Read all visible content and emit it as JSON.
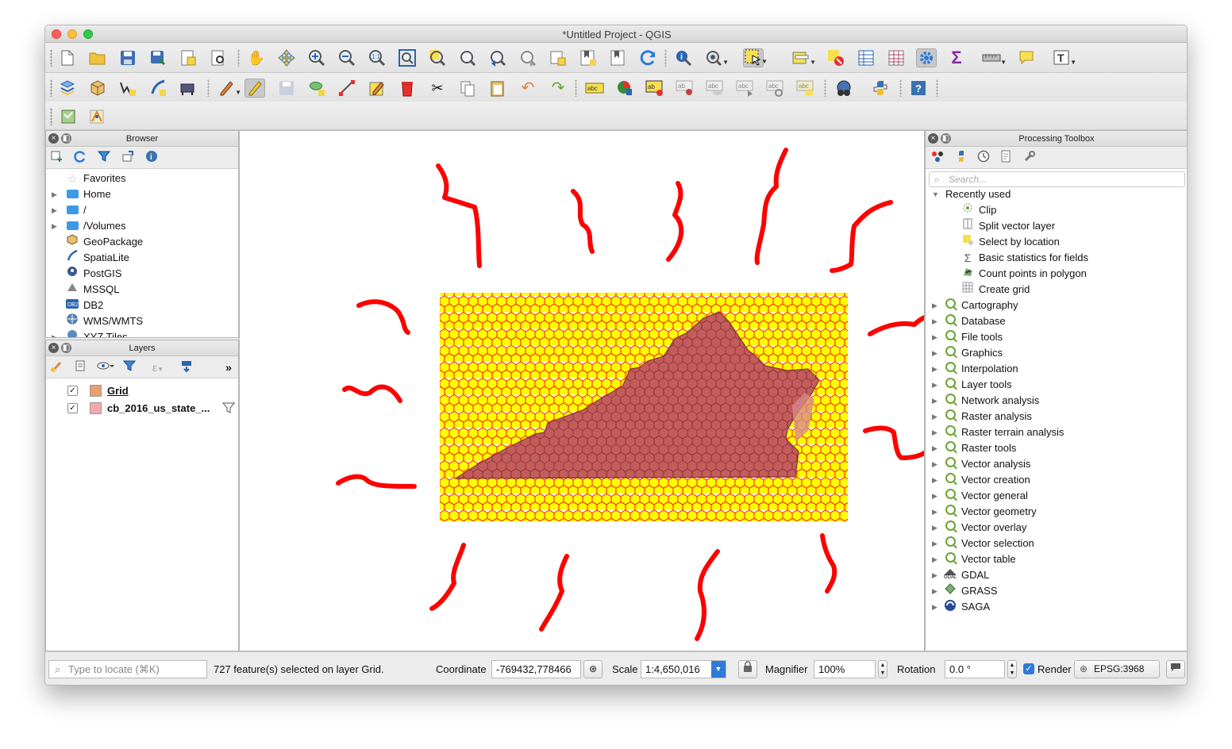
{
  "window": {
    "title": "*Untitled Project - QGIS"
  },
  "toolbar1": {
    "icons": [
      "new-project-icon",
      "open-project-icon",
      "save-project-icon",
      "save-as-icon",
      "new-print-layout-icon",
      "layout-manager-icon",
      "pan-icon",
      "pan-to-selection-icon",
      "zoom-in-icon",
      "zoom-out-icon",
      "zoom-native-icon",
      "zoom-full-icon",
      "zoom-to-selection-icon",
      "zoom-to-layer-icon",
      "zoom-last-icon",
      "zoom-next-icon",
      "new-map-view-icon",
      "new-bookmark-icon",
      "show-bookmarks-icon",
      "refresh-icon",
      "identify-icon",
      "run-action-icon",
      "select-features-icon",
      "select-by-value-icon",
      "deselect-icon",
      "attribute-table-icon",
      "field-calculator-icon",
      "processing-toolbox-icon",
      "statistics-icon",
      "measure-icon",
      "map-tips-icon",
      "text-annotation-icon"
    ]
  },
  "toolbar2": {
    "icons": [
      "data-source-manager-icon",
      "new-geopackage-layer-icon",
      "new-shapefile-layer-icon",
      "new-spatialite-layer-icon",
      "new-virtual-layer-icon",
      "current-edits-icon",
      "toggle-editing-icon",
      "save-edits-icon",
      "add-feature-icon",
      "vertex-tool-icon",
      "modify-attributes-icon",
      "delete-selected-icon",
      "cut-features-icon",
      "copy-features-icon",
      "paste-features-icon",
      "undo-icon",
      "redo-icon",
      "label-layer-icon",
      "diagram-icon",
      "highlight-pinned-labels-icon",
      "pin-labels-icon",
      "show-hide-labels-icon",
      "move-label-icon",
      "rotate-label-icon",
      "change-label-icon",
      "metasearch-icon",
      "python-console-icon",
      "help-icon"
    ]
  },
  "toolbar3": {
    "icons": [
      "georeferencer-icon",
      "plugin-tool-icon"
    ]
  },
  "browser": {
    "title": "Browser",
    "tools": [
      "add-selected-layers-icon",
      "refresh-icon",
      "filter-icon",
      "collapse-all-icon",
      "properties-icon"
    ],
    "items": [
      {
        "label": "Favorites",
        "icon": "star-icon",
        "expandable": false
      },
      {
        "label": "Home",
        "icon": "folder-icon",
        "expandable": true
      },
      {
        "label": "/",
        "icon": "folder-icon",
        "expandable": true
      },
      {
        "label": "/Volumes",
        "icon": "folder-icon",
        "expandable": true
      },
      {
        "label": "GeoPackage",
        "icon": "geopackage-icon",
        "expandable": false
      },
      {
        "label": "SpatiaLite",
        "icon": "spatialite-icon",
        "expandable": false
      },
      {
        "label": "PostGIS",
        "icon": "postgis-icon",
        "expandable": false
      },
      {
        "label": "MSSQL",
        "icon": "mssql-icon",
        "expandable": false
      },
      {
        "label": "DB2",
        "icon": "db2-icon",
        "expandable": false
      },
      {
        "label": "WMS/WMTS",
        "icon": "wms-icon",
        "expandable": false
      },
      {
        "label": "XYZ Tiles",
        "icon": "xyz-icon",
        "expandable": true
      }
    ]
  },
  "layers": {
    "title": "Layers",
    "tools": [
      "style-manager-icon",
      "add-group-icon",
      "manage-visibility-icon",
      "filter-legend-icon",
      "filter-by-expression-icon",
      "expand-all-icon",
      "more-icon"
    ],
    "items": [
      {
        "name": "Grid",
        "checked": true,
        "color": "#e8a070",
        "underline": true,
        "filter_icon": false
      },
      {
        "name": "cb_2016_us_state_...",
        "checked": true,
        "color": "#f4a8ae",
        "underline": false,
        "filter_icon": true
      }
    ]
  },
  "toolbox": {
    "title": "Processing Toolbox",
    "tools": [
      "models-icon",
      "scripts-icon",
      "history-icon",
      "results-viewer-icon",
      "options-icon"
    ],
    "search_placeholder": "Search...",
    "recent_label": "Recently used",
    "recent": [
      {
        "label": "Clip",
        "icon": "clip-icon"
      },
      {
        "label": "Split vector layer",
        "icon": "split-icon"
      },
      {
        "label": "Select by location",
        "icon": "select-location-icon"
      },
      {
        "label": "Basic statistics for fields",
        "icon": "sigma-icon"
      },
      {
        "label": "Count points in polygon",
        "icon": "count-points-icon"
      },
      {
        "label": "Create grid",
        "icon": "grid-icon"
      }
    ],
    "groups": [
      {
        "label": "Cartography",
        "icon": "qgis-icon"
      },
      {
        "label": "Database",
        "icon": "qgis-icon"
      },
      {
        "label": "File tools",
        "icon": "qgis-icon"
      },
      {
        "label": "Graphics",
        "icon": "qgis-icon"
      },
      {
        "label": "Interpolation",
        "icon": "qgis-icon"
      },
      {
        "label": "Layer tools",
        "icon": "qgis-icon"
      },
      {
        "label": "Network analysis",
        "icon": "qgis-icon"
      },
      {
        "label": "Raster analysis",
        "icon": "qgis-icon"
      },
      {
        "label": "Raster terrain analysis",
        "icon": "qgis-icon"
      },
      {
        "label": "Raster tools",
        "icon": "qgis-icon"
      },
      {
        "label": "Vector analysis",
        "icon": "qgis-icon"
      },
      {
        "label": "Vector creation",
        "icon": "qgis-icon"
      },
      {
        "label": "Vector general",
        "icon": "qgis-icon"
      },
      {
        "label": "Vector geometry",
        "icon": "qgis-icon"
      },
      {
        "label": "Vector overlay",
        "icon": "qgis-icon"
      },
      {
        "label": "Vector selection",
        "icon": "qgis-icon"
      },
      {
        "label": "Vector table",
        "icon": "qgis-icon"
      },
      {
        "label": "GDAL",
        "icon": "gdal-icon"
      },
      {
        "label": "GRASS",
        "icon": "grass-icon"
      },
      {
        "label": "SAGA",
        "icon": "saga-icon"
      }
    ]
  },
  "statusbar": {
    "locate_placeholder": "Type to locate (⌘K)",
    "message": "727 feature(s) selected on layer Grid.",
    "coordinate_label": "Coordinate",
    "coordinate_value": "-769432,778466",
    "scale_label": "Scale",
    "scale_value": "1:4,650,016",
    "magnifier_label": "Magnifier",
    "magnifier_value": "100%",
    "rotation_label": "Rotation",
    "rotation_value": "0.0 °",
    "render_label": "Render",
    "render_checked": true,
    "crs_label": "EPSG:3968"
  },
  "colors": {
    "selected_fill": "#ffff00",
    "selection_stroke": "#ff0000",
    "state_fill": "#c45c5c",
    "annotation": "#ff0000",
    "accent": "#2f7bd6"
  }
}
